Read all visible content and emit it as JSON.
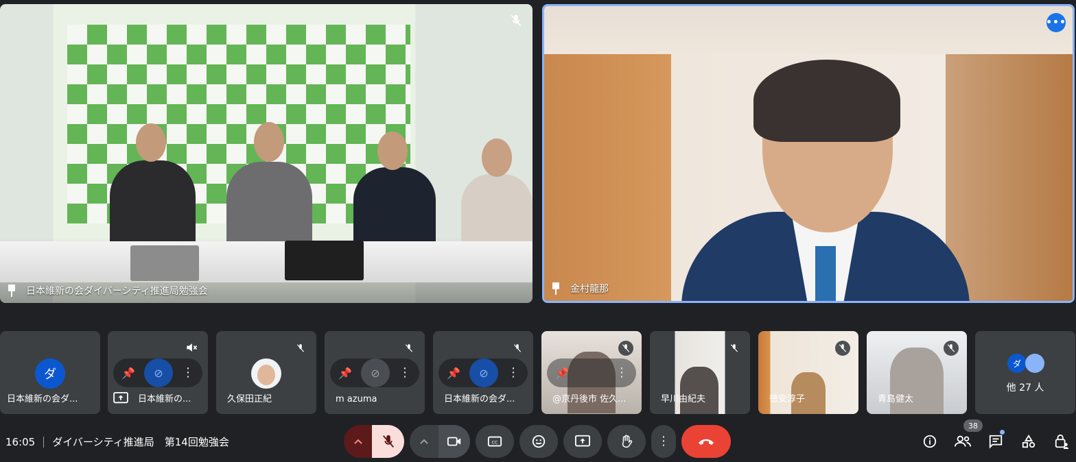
{
  "main_tiles": [
    {
      "name": "日本維新の会ダイバーシティ推進局勉強会"
    },
    {
      "name": "金村龍那"
    }
  ],
  "filmstrip": [
    {
      "initial": "ダ",
      "label": "日本維新の会ダ..."
    },
    {
      "label": "日本維新の..."
    },
    {
      "label": "久保田正紀"
    },
    {
      "label": "m azuma"
    },
    {
      "label": "日本維新の会ダ..."
    },
    {
      "label": "@京丹後市 佐久..."
    },
    {
      "label": "早川由紀夫"
    },
    {
      "label": "徳安淳子"
    },
    {
      "label": "青島健太"
    }
  ],
  "others": {
    "initial": "ダ",
    "label": "他 27 人"
  },
  "meeting": {
    "time": "16:05",
    "title": "ダイバーシティ推進局　第14回勉強会"
  },
  "participants_count": "38",
  "colors": {
    "end_call": "#ea4335",
    "mic_off_bg": "#f9dedc",
    "accent": "#1a73e8"
  }
}
